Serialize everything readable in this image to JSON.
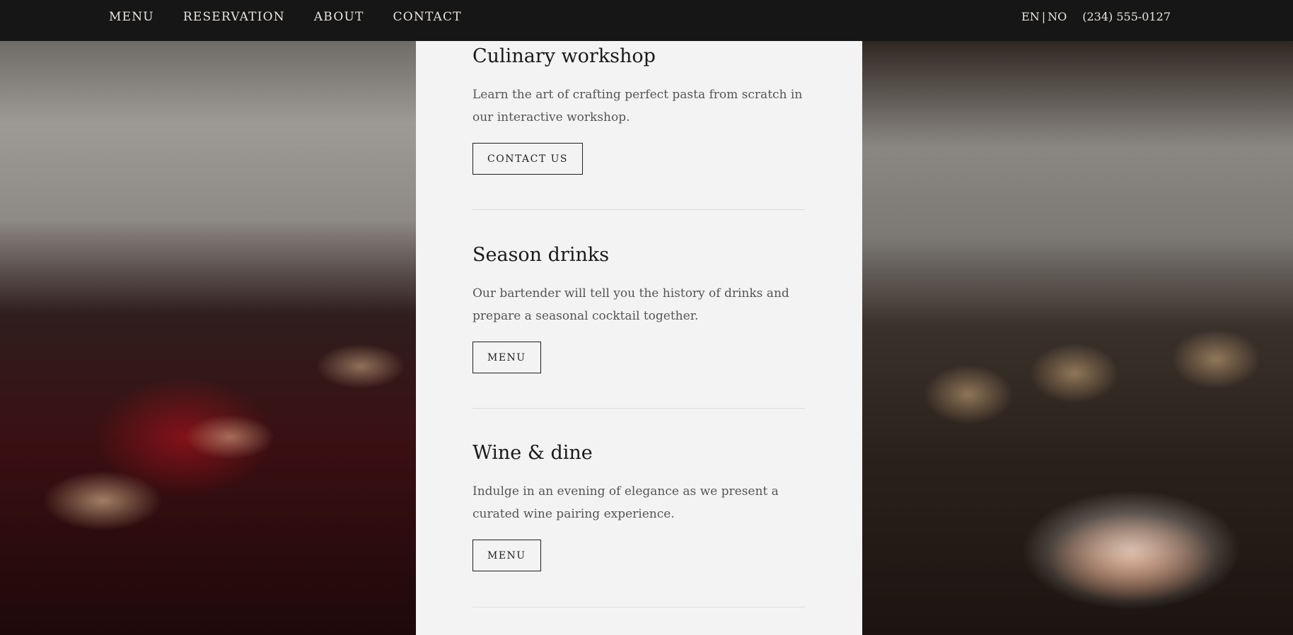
{
  "nav": {
    "items": [
      "MENU",
      "RESERVATION",
      "ABOUT",
      "CONTACT"
    ]
  },
  "header": {
    "lang_en": "EN",
    "lang_sep": "|",
    "lang_no": "NO",
    "phone": "(234) 555-0127"
  },
  "sections": [
    {
      "title": "Culinary workshop",
      "description": "Learn the art of crafting perfect pasta from scratch in our interactive workshop.",
      "button": "CONTACT US"
    },
    {
      "title": "Season drinks",
      "description": "Our bartender will tell you the history of drinks and prepare a seasonal cocktail together.",
      "button": "MENU"
    },
    {
      "title": "Wine & dine",
      "description": "Indulge in an evening of elegance as we present a curated wine pairing experience.",
      "button": "MENU"
    }
  ],
  "colors": {
    "topbar_bg": "#161616",
    "panel_bg": "#f3f3f3",
    "text_dark": "#1a1a1a",
    "text_muted": "#555555"
  }
}
